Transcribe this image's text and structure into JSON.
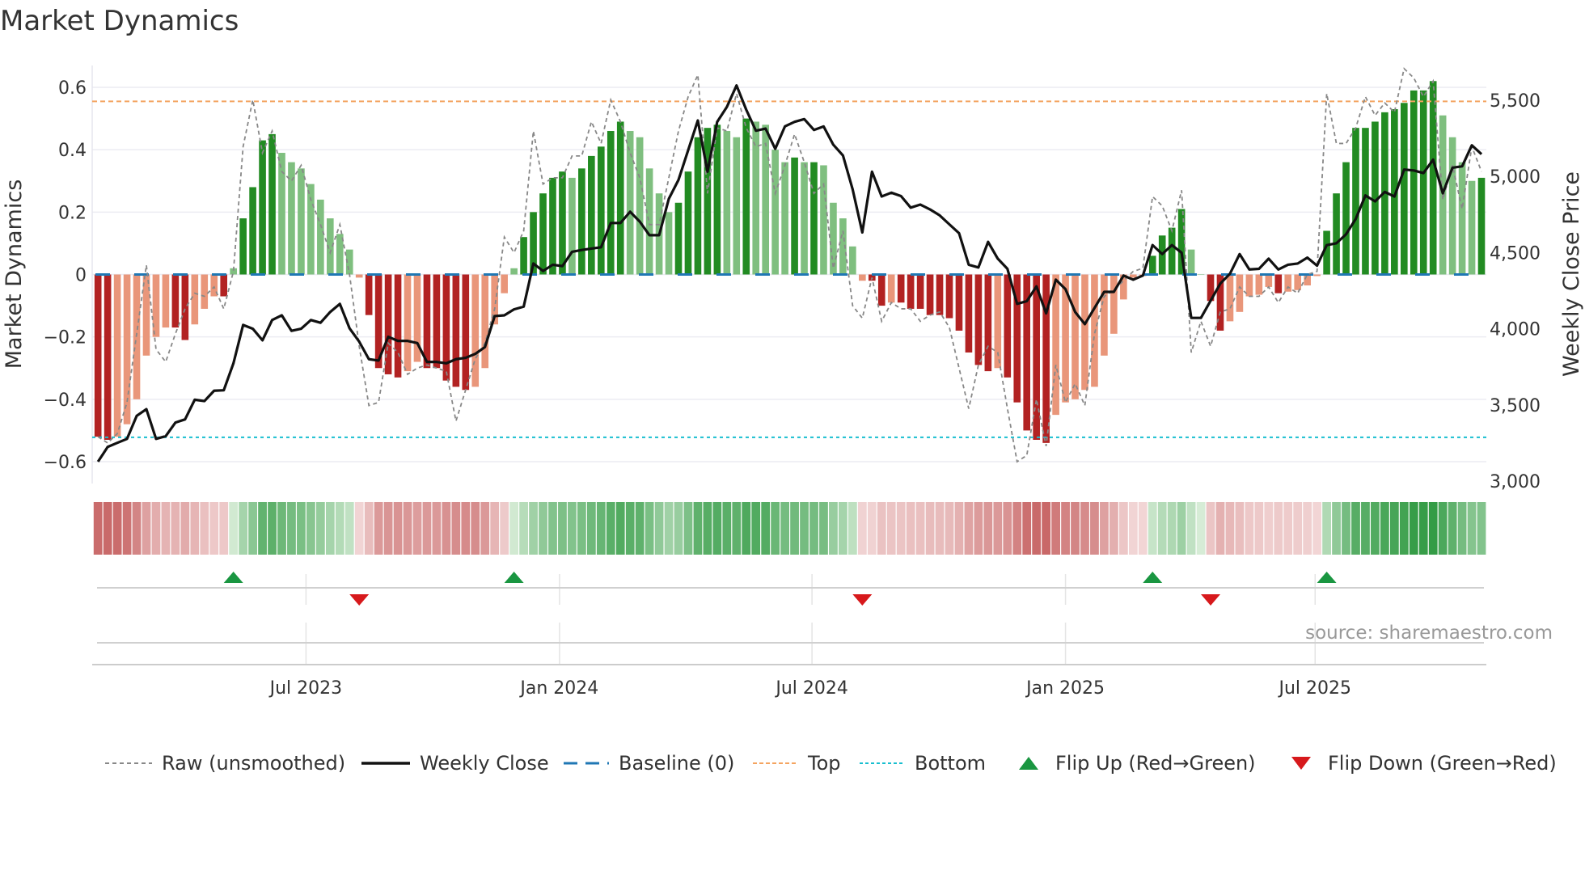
{
  "title": "Market Dynamics",
  "source": "source: sharemaestro.com",
  "legend": {
    "raw": "Raw (unsmoothed)",
    "close": "Weekly Close",
    "baseline": "Baseline (0)",
    "top": "Top",
    "bottom": "Bottom",
    "flip_up": "Flip Up (Red→Green)",
    "flip_down": "Flip Down (Green→Red)"
  },
  "colors": {
    "green_strong": "#228B22",
    "green_weak": "#7FBF7F",
    "red_strong": "#B22222",
    "red_weak": "#E9967A",
    "close": "#111111",
    "raw": "#888888",
    "baseline": "#1f77b4",
    "top": "#f4a460",
    "bottom": "#17becf",
    "flip_up": "#1a9641",
    "flip_down": "#d7191c"
  },
  "chart_data": {
    "type": "bar",
    "title": "Market Dynamics",
    "ylabel": "Market Dynamics",
    "y2label": "Weekly Close Price",
    "ylim": [
      -0.67,
      0.67
    ],
    "y2lim": [
      2984,
      5728
    ],
    "xlim": [
      -0.6,
      143.5
    ],
    "yticks": [
      {
        "v": 0.6,
        "label": "0.6"
      },
      {
        "v": 0.4,
        "label": "0.4"
      },
      {
        "v": 0.2,
        "label": "0.2"
      },
      {
        "v": 0,
        "label": "0"
      },
      {
        "v": -0.2,
        "label": "−0.2"
      },
      {
        "v": -0.4,
        "label": "−0.4"
      },
      {
        "v": -0.6,
        "label": "−0.6"
      }
    ],
    "y2ticks": [
      {
        "v": 5500,
        "label": "5,500"
      },
      {
        "v": 5000,
        "label": "5,000"
      },
      {
        "v": 4500,
        "label": "4,500"
      },
      {
        "v": 4000,
        "label": "4,000"
      },
      {
        "v": 3500,
        "label": "3,500"
      },
      {
        "v": 3000,
        "label": "3,000"
      }
    ],
    "x_ticks": [
      {
        "index": 21.5,
        "label": "Jul 2023"
      },
      {
        "index": 47.7,
        "label": "Jan 2024"
      },
      {
        "index": 73.8,
        "label": "Jul 2024"
      },
      {
        "index": 100,
        "label": "Jan 2025"
      },
      {
        "index": 125.8,
        "label": "Jul 2025"
      }
    ],
    "top_level": 0.555,
    "bottom_level": -0.522,
    "baseline": 0,
    "dynamics": [
      -0.52,
      -0.53,
      -0.52,
      -0.48,
      -0.4,
      -0.26,
      -0.2,
      -0.17,
      -0.17,
      -0.21,
      -0.16,
      -0.11,
      -0.07,
      -0.07,
      0.02,
      0.18,
      0.28,
      0.43,
      0.45,
      0.39,
      0.36,
      0.34,
      0.29,
      0.24,
      0.18,
      0.13,
      0.08,
      -0.01,
      -0.13,
      -0.3,
      -0.32,
      -0.33,
      -0.31,
      -0.28,
      -0.3,
      -0.3,
      -0.34,
      -0.36,
      -0.37,
      -0.36,
      -0.3,
      -0.16,
      -0.06,
      0.02,
      0.12,
      0.2,
      0.26,
      0.31,
      0.33,
      0.31,
      0.34,
      0.38,
      0.41,
      0.46,
      0.49,
      0.46,
      0.44,
      0.34,
      0.26,
      0.2,
      0.23,
      0.33,
      0.44,
      0.47,
      0.48,
      0.46,
      0.44,
      0.5,
      0.49,
      0.48,
      0.4,
      0.36,
      0.375,
      0.36,
      0.36,
      0.35,
      0.23,
      0.18,
      0.09,
      -0.02,
      -0.02,
      -0.1,
      -0.09,
      -0.09,
      -0.11,
      -0.11,
      -0.13,
      -0.13,
      -0.14,
      -0.18,
      -0.25,
      -0.29,
      -0.31,
      -0.3,
      -0.33,
      -0.41,
      -0.5,
      -0.53,
      -0.54,
      -0.45,
      -0.41,
      -0.4,
      -0.37,
      -0.36,
      -0.26,
      -0.19,
      -0.08,
      -0.01,
      -0.005,
      0.06,
      0.125,
      0.15,
      0.21,
      0.08,
      0,
      -0.085,
      -0.18,
      -0.15,
      -0.12,
      -0.07,
      -0.065,
      -0.04,
      -0.06,
      -0.055,
      -0.05,
      -0.035,
      -0.005,
      0.14,
      0.26,
      0.36,
      0.47,
      0.47,
      0.49,
      0.52,
      0.53,
      0.55,
      0.59,
      0.59,
      0.62,
      0.51,
      0.44,
      0.36,
      0.3,
      0.31
    ],
    "raw": [
      -0.52,
      -0.54,
      -0.51,
      -0.41,
      -0.19,
      0.03,
      -0.24,
      -0.28,
      -0.19,
      -0.11,
      -0.06,
      -0.07,
      -0.04,
      -0.11,
      0.01,
      0.41,
      0.56,
      0.39,
      0.46,
      0.33,
      0.3,
      0.35,
      0.24,
      0.16,
      0.07,
      0.16,
      0,
      -0.23,
      -0.42,
      -0.41,
      -0.22,
      -0.25,
      -0.32,
      -0.3,
      -0.29,
      -0.3,
      -0.31,
      -0.47,
      -0.37,
      -0.27,
      -0.22,
      -0.11,
      0.12,
      0.07,
      0.14,
      0.46,
      0.29,
      0.31,
      0.31,
      0.38,
      0.38,
      0.49,
      0.42,
      0.56,
      0.49,
      0.39,
      0.31,
      0.16,
      0.16,
      0.31,
      0.46,
      0.57,
      0.64,
      0.26,
      0.47,
      0.46,
      0.58,
      0.47,
      0.41,
      0.42,
      0.26,
      0.35,
      0.45,
      0.36,
      0.26,
      0.29,
      0.02,
      0.14,
      -0.1,
      -0.14,
      -0.01,
      -0.15,
      -0.09,
      -0.11,
      -0.11,
      -0.15,
      -0.13,
      -0.12,
      -0.17,
      -0.3,
      -0.43,
      -0.29,
      -0.23,
      -0.25,
      -0.43,
      -0.6,
      -0.58,
      -0.4,
      -0.55,
      -0.29,
      -0.41,
      -0.35,
      -0.42,
      -0.19,
      -0.07,
      -0.05,
      -0.02,
      0.01,
      0.02,
      0.25,
      0.22,
      0.14,
      0.27,
      -0.25,
      -0.15,
      -0.23,
      -0.12,
      -0.11,
      -0.04,
      -0.07,
      -0.07,
      -0.04,
      -0.09,
      -0.04,
      -0.06,
      0,
      0.01,
      0.58,
      0.42,
      0.42,
      0.47,
      0.57,
      0.51,
      0.55,
      0.52,
      0.66,
      0.63,
      0.57,
      0.62,
      0.24,
      0.35,
      0.21,
      0.41,
      0.33
    ],
    "weekly_close": [
      3127,
      3224,
      3251,
      3277,
      3428,
      3472,
      3277,
      3295,
      3384,
      3405,
      3534,
      3525,
      3593,
      3596,
      3773,
      4025,
      4000,
      3924,
      4057,
      4088,
      3986,
      4000,
      4057,
      4039,
      4110,
      4163,
      4003,
      3915,
      3800,
      3791,
      3947,
      3920,
      3920,
      3906,
      3782,
      3782,
      3773,
      3800,
      3809,
      3835,
      3880,
      4083,
      4088,
      4127,
      4145,
      4428,
      4379,
      4420,
      4411,
      4505,
      4517,
      4526,
      4535,
      4694,
      4694,
      4768,
      4703,
      4614,
      4614,
      4853,
      4977,
      5172,
      5367,
      5031,
      5358,
      5456,
      5597,
      5438,
      5300,
      5314,
      5181,
      5328,
      5358,
      5376,
      5305,
      5328,
      5208,
      5137,
      4915,
      4632,
      5031,
      4868,
      4893,
      4871,
      4795,
      4815,
      4783,
      4744,
      4685,
      4627,
      4420,
      4402,
      4570,
      4460,
      4393,
      4163,
      4181,
      4278,
      4101,
      4322,
      4260,
      4110,
      4030,
      4136,
      4242,
      4242,
      4349,
      4322,
      4349,
      4549,
      4490,
      4549,
      4499,
      4071,
      4071,
      4184,
      4296,
      4361,
      4490,
      4389,
      4393,
      4460,
      4389,
      4420,
      4428,
      4467,
      4414,
      4549,
      4561,
      4620,
      4721,
      4875,
      4836,
      4898,
      4868,
      5045,
      5039,
      5022,
      5110,
      4889,
      5057,
      5066,
      5204,
      5146
    ],
    "flip_up_index": [
      14,
      43,
      109,
      127
    ],
    "flip_down_index": [
      27,
      79,
      115
    ]
  }
}
